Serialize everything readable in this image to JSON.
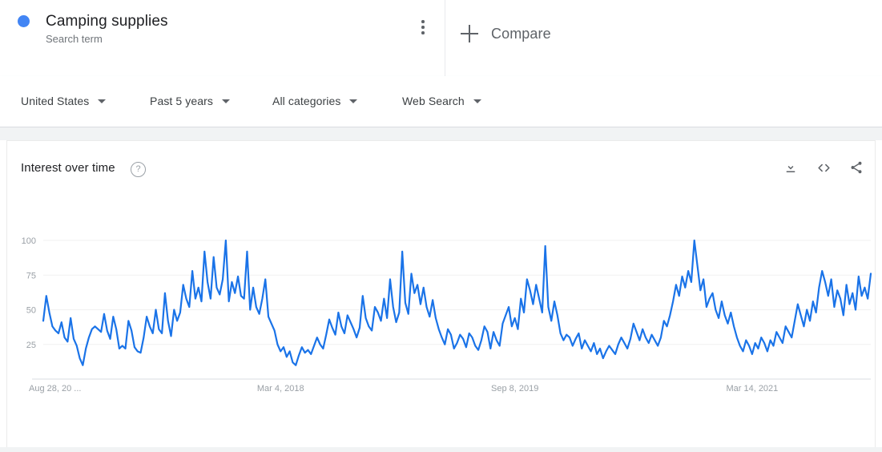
{
  "term": {
    "dot_color": "#4285f4",
    "title": "Camping supplies",
    "subtitle": "Search term",
    "menu_icon": "more-vertical-icon"
  },
  "compare": {
    "plus_icon": "plus-icon",
    "label": "Compare"
  },
  "filters": [
    {
      "label": "United States",
      "caret_icon": "chevron-down-icon"
    },
    {
      "label": "Past 5 years",
      "caret_icon": "chevron-down-icon"
    },
    {
      "label": "All categories",
      "caret_icon": "chevron-down-icon"
    },
    {
      "label": "Web Search",
      "caret_icon": "chevron-down-icon"
    }
  ],
  "panel": {
    "title": "Interest over time",
    "help_icon": "help-circle-icon",
    "help_glyph": "?",
    "actions": [
      {
        "name": "download-icon",
        "tooltip": "Download"
      },
      {
        "name": "embed-code-icon",
        "tooltip": "Embed"
      },
      {
        "name": "share-icon",
        "tooltip": "Share"
      }
    ]
  },
  "chart_data": {
    "type": "line",
    "title": "Interest over time",
    "xlabel": "",
    "ylabel": "",
    "ylim": [
      0,
      100
    ],
    "yticks": [
      25,
      50,
      75,
      100
    ],
    "ytick_labels": [
      "25",
      "50",
      "75",
      "100"
    ],
    "grid": true,
    "legend": false,
    "line_color": "#1a73e8",
    "line_width": 2.2,
    "x_tick_labels": [
      "Aug 28, 20 ...",
      "Mar 4, 2018",
      "Sep 8, 2019",
      "Mar 14, 2021"
    ],
    "x_tick_positions": [
      0,
      78,
      155,
      233
    ],
    "x_start": "Aug 28, 2016",
    "x_end": "Aug 2021",
    "x_interval": "weekly",
    "series": [
      {
        "name": "Camping supplies",
        "values": [
          42,
          60,
          48,
          38,
          35,
          33,
          41,
          30,
          27,
          44,
          29,
          24,
          15,
          10,
          22,
          30,
          36,
          38,
          36,
          34,
          47,
          35,
          29,
          45,
          36,
          22,
          24,
          22,
          42,
          35,
          23,
          20,
          19,
          30,
          45,
          38,
          33,
          50,
          36,
          33,
          62,
          42,
          31,
          50,
          42,
          48,
          68,
          58,
          52,
          78,
          58,
          66,
          56,
          92,
          70,
          58,
          88,
          66,
          61,
          72,
          100,
          56,
          70,
          62,
          74,
          60,
          58,
          92,
          50,
          66,
          52,
          47,
          58,
          72,
          45,
          40,
          35,
          25,
          20,
          23,
          16,
          20,
          12,
          10,
          17,
          23,
          19,
          21,
          18,
          24,
          30,
          25,
          22,
          32,
          43,
          37,
          32,
          48,
          38,
          33,
          46,
          41,
          36,
          30,
          37,
          60,
          44,
          38,
          35,
          52,
          48,
          42,
          58,
          44,
          72,
          52,
          41,
          48,
          92,
          55,
          47,
          76,
          62,
          68,
          54,
          66,
          52,
          45,
          57,
          44,
          36,
          30,
          25,
          36,
          32,
          22,
          26,
          32,
          29,
          23,
          33,
          30,
          24,
          21,
          28,
          38,
          34,
          22,
          34,
          28,
          24,
          40,
          46,
          52,
          38,
          44,
          36,
          58,
          48,
          72,
          64,
          54,
          68,
          58,
          48,
          96,
          52,
          42,
          56,
          46,
          33,
          28,
          32,
          30,
          24,
          29,
          33,
          22,
          28,
          24,
          20,
          26,
          18,
          22,
          15,
          20,
          24,
          21,
          18,
          25,
          30,
          26,
          22,
          29,
          40,
          34,
          28,
          36,
          30,
          26,
          32,
          28,
          24,
          30,
          42,
          38,
          46,
          56,
          68,
          60,
          74,
          66,
          78,
          70,
          100,
          82,
          64,
          72,
          52,
          58,
          62,
          50,
          44,
          56,
          46,
          40,
          48,
          38,
          30,
          24,
          20,
          28,
          24,
          18,
          26,
          22,
          30,
          26,
          20,
          28,
          24,
          34,
          30,
          26,
          38,
          34,
          30,
          42,
          54,
          46,
          38,
          50,
          42,
          56,
          48,
          66,
          78,
          70,
          60,
          72,
          52,
          64,
          58,
          46,
          68,
          54,
          62,
          50,
          74,
          60,
          66,
          58,
          76
        ]
      }
    ]
  }
}
